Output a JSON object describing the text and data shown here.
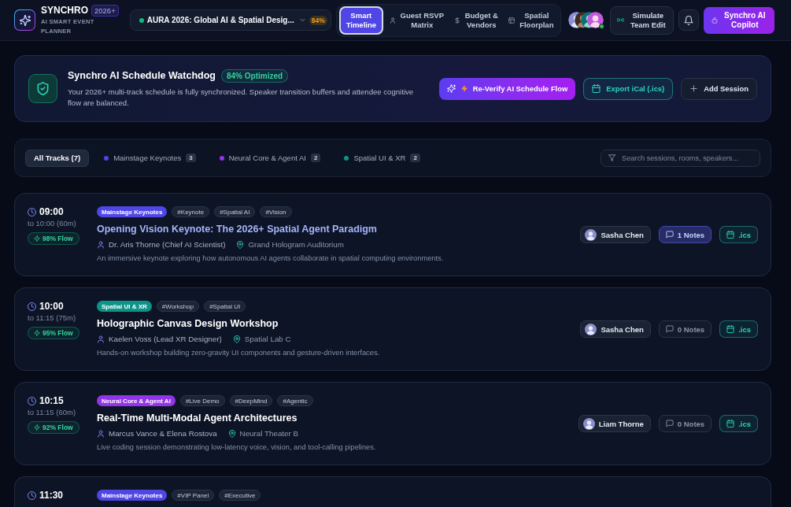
{
  "header": {
    "brand": {
      "name": "SYNCHRO",
      "badge": "2026+",
      "tagline": "AI SMART EVENT PLANNER"
    },
    "event_selector": {
      "value": "AURA 2026: Global AI & Spatial Desig...",
      "live": true,
      "score": "84%"
    },
    "nav_tabs": [
      {
        "label": "Smart Timeline",
        "selected": true
      },
      {
        "label": "Guest RSVP Matrix",
        "selected": false
      },
      {
        "label": "Budget & Vendors",
        "selected": false
      },
      {
        "label": "Spatial Floorplan",
        "selected": false
      }
    ],
    "collaborators": [
      {
        "online": false
      },
      {
        "online": false
      },
      {
        "online": false
      },
      {
        "online": true
      }
    ],
    "simulate_button": "Simulate Team Edit",
    "copilot_button": "Synchro AI Copilot"
  },
  "watchdog": {
    "title": "Synchro AI Schedule Watchdog",
    "badge": "84% Optimized",
    "description": "Your 2026+ multi-track schedule is fully synchronized. Speaker transition buffers and attendee cognitive flow are balanced.",
    "buttons": [
      {
        "label": "Re-Verify AI Schedule Flow",
        "kind": "primary"
      },
      {
        "label": "Export iCal (.ics)",
        "kind": "export"
      },
      {
        "label": "Add Session",
        "kind": "secondary"
      }
    ]
  },
  "filters": {
    "tracks": [
      {
        "label": "All Tracks (7)",
        "selected": true
      },
      {
        "label": "Mainstage Keynotes",
        "count": "3",
        "color": "#4f46e5",
        "selected": false
      },
      {
        "label": "Neural Core & Agent AI",
        "count": "2",
        "color": "#9333ea",
        "selected": false
      },
      {
        "label": "Spatial UI & XR",
        "count": "2",
        "color": "#0d9488",
        "selected": false
      }
    ],
    "search": {
      "placeholder": "Search sessions, rooms, speakers..."
    }
  },
  "sessions": [
    {
      "start": "09:00",
      "end": "to 10:00 (60m)",
      "flow": "98% Flow",
      "track": {
        "label": "Mainstage Keynotes",
        "color": "#4f46e5"
      },
      "tags": [
        "#Keynote",
        "#Spatial AI",
        "#Vision"
      ],
      "title": "Opening Vision Keynote: The 2026+ Spatial Agent Paradigm",
      "highlighted": true,
      "speaker": "Dr. Aris Thorne (Chief AI Scientist)",
      "room": "Grand Hologram Auditorium",
      "description": "An immersive keynote exploring how autonomous AI agents collaborate in spatial computing environments.",
      "host": "Sasha Chen",
      "notes": {
        "label": "1 Notes",
        "active": true
      },
      "ics": ".ics"
    },
    {
      "start": "10:00",
      "end": "to 11:15 (75m)",
      "flow": "95% Flow",
      "track": {
        "label": "Spatial UI & XR",
        "color": "#0d9488"
      },
      "tags": [
        "#Workshop",
        "#Spatial UI"
      ],
      "title": "Holographic Canvas Design Workshop",
      "highlighted": false,
      "speaker": "Kaelen Voss (Lead XR Designer)",
      "room": "Spatial Lab C",
      "description": "Hands-on workshop building zero-gravity UI components and gesture-driven interfaces.",
      "host": "Sasha Chen",
      "notes": {
        "label": "0 Notes",
        "active": false
      },
      "ics": ".ics"
    },
    {
      "start": "10:15",
      "end": "to 11:15 (60m)",
      "flow": "92% Flow",
      "track": {
        "label": "Neural Core & Agent AI",
        "color": "#9333ea"
      },
      "tags": [
        "#Live Demo",
        "#DeepMind",
        "#Agentic"
      ],
      "title": "Real-Time Multi-Modal Agent Architectures",
      "highlighted": false,
      "speaker": "Marcus Vance & Elena Rostova",
      "room": "Neural Theater B",
      "description": "Live coding session demonstrating low-latency voice, vision, and tool-calling pipelines.",
      "host": "Liam Thorne",
      "notes": {
        "label": "0 Notes",
        "active": false
      },
      "ics": ".ics"
    },
    {
      "start": "11:30",
      "track": {
        "label": "Mainstage Keynotes",
        "color": "#4f46e5"
      },
      "tags": [
        "#VIP Panel",
        "#Executive"
      ]
    }
  ]
}
